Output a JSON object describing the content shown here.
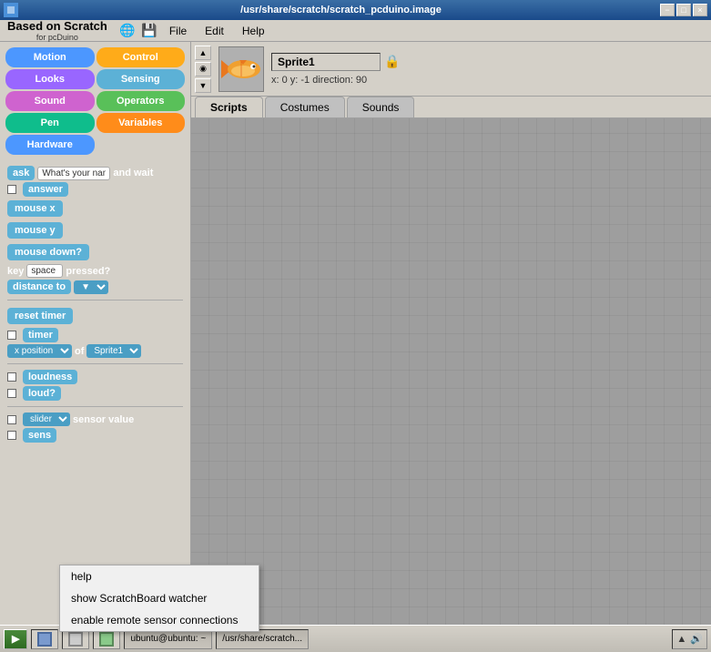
{
  "titlebar": {
    "text": "/usr/share/scratch/scratch_pcduino.image",
    "minimize": "−",
    "maximize": "□",
    "close": "×"
  },
  "menubar": {
    "brand_main": "Based on Scratch",
    "brand_sub": "for pcDuino",
    "file": "File",
    "edit": "Edit",
    "help": "Help"
  },
  "categories": {
    "motion": "Motion",
    "control": "Control",
    "looks": "Looks",
    "sensing": "Sensing",
    "sound": "Sound",
    "operators": "Operators",
    "pen": "Pen",
    "variables": "Variables",
    "hardware": "Hardware"
  },
  "blocks": {
    "ask_prefix": "ask",
    "ask_input": "What's your name?",
    "ask_suffix": "and wait",
    "answer": "answer",
    "mouse_x": "mouse x",
    "mouse_y": "mouse y",
    "mouse_down": "mouse down?",
    "key_prefix": "key",
    "key_input": "space",
    "key_suffix": "pressed?",
    "distance_prefix": "distance to",
    "reset_timer": "reset timer",
    "timer": "timer",
    "x_position": "x position",
    "of": "of",
    "sprite1": "Sprite1",
    "loudness": "loudness",
    "loud": "loud?",
    "slider": "slider",
    "sensor_value": "sensor value",
    "sens": "sens"
  },
  "sprite": {
    "name": "Sprite1",
    "x": "0",
    "y": "-1",
    "direction": "90",
    "coords_label": "x: 0   y: -1   direction: 90"
  },
  "tabs": {
    "scripts": "Scripts",
    "costumes": "Costumes",
    "sounds": "Sounds"
  },
  "context_menu": {
    "items": [
      "help",
      "show ScratchBoard watcher",
      "enable remote sensor connections"
    ]
  },
  "taskbar": {
    "start": "▶",
    "items": [
      "ubuntu@ubuntu: ~",
      "/usr/share/scratch..."
    ]
  }
}
